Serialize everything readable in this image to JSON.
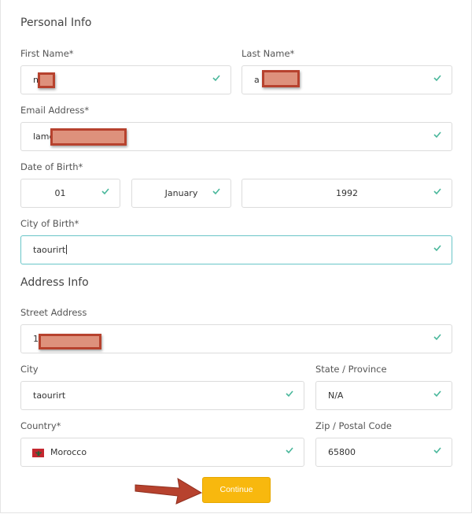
{
  "personal": {
    "title": "Personal Info",
    "first_name_label": "First Name*",
    "first_name_value": "n",
    "last_name_label": "Last Name*",
    "last_name_value": "a",
    "email_label": "Email Address*",
    "email_value": "lame",
    "dob_label": "Date of Birth*",
    "dob_day": "01",
    "dob_month": "January",
    "dob_year": "1992",
    "city_of_birth_label": "City of Birth*",
    "city_of_birth_value": "taourirt"
  },
  "address": {
    "title": "Address Info",
    "street_label": "Street Address",
    "street_value": "1",
    "city_label": "City",
    "city_value": "taourirt",
    "state_label": "State / Province",
    "state_value": "N/A",
    "country_label": "Country*",
    "country_value": "Morocco",
    "zip_label": "Zip / Postal Code",
    "zip_value": "65800"
  },
  "actions": {
    "continue_label": "Continue"
  },
  "icons": {
    "valid": "check-icon",
    "country_flag": "morocco-flag-icon",
    "annotation": "arrow-icon"
  },
  "colors": {
    "valid_check": "#49b79b",
    "focus_border": "#69c5c8",
    "button": "#f8b80e",
    "redaction": "#de917c",
    "annotation_arrow": "#b7422e"
  }
}
